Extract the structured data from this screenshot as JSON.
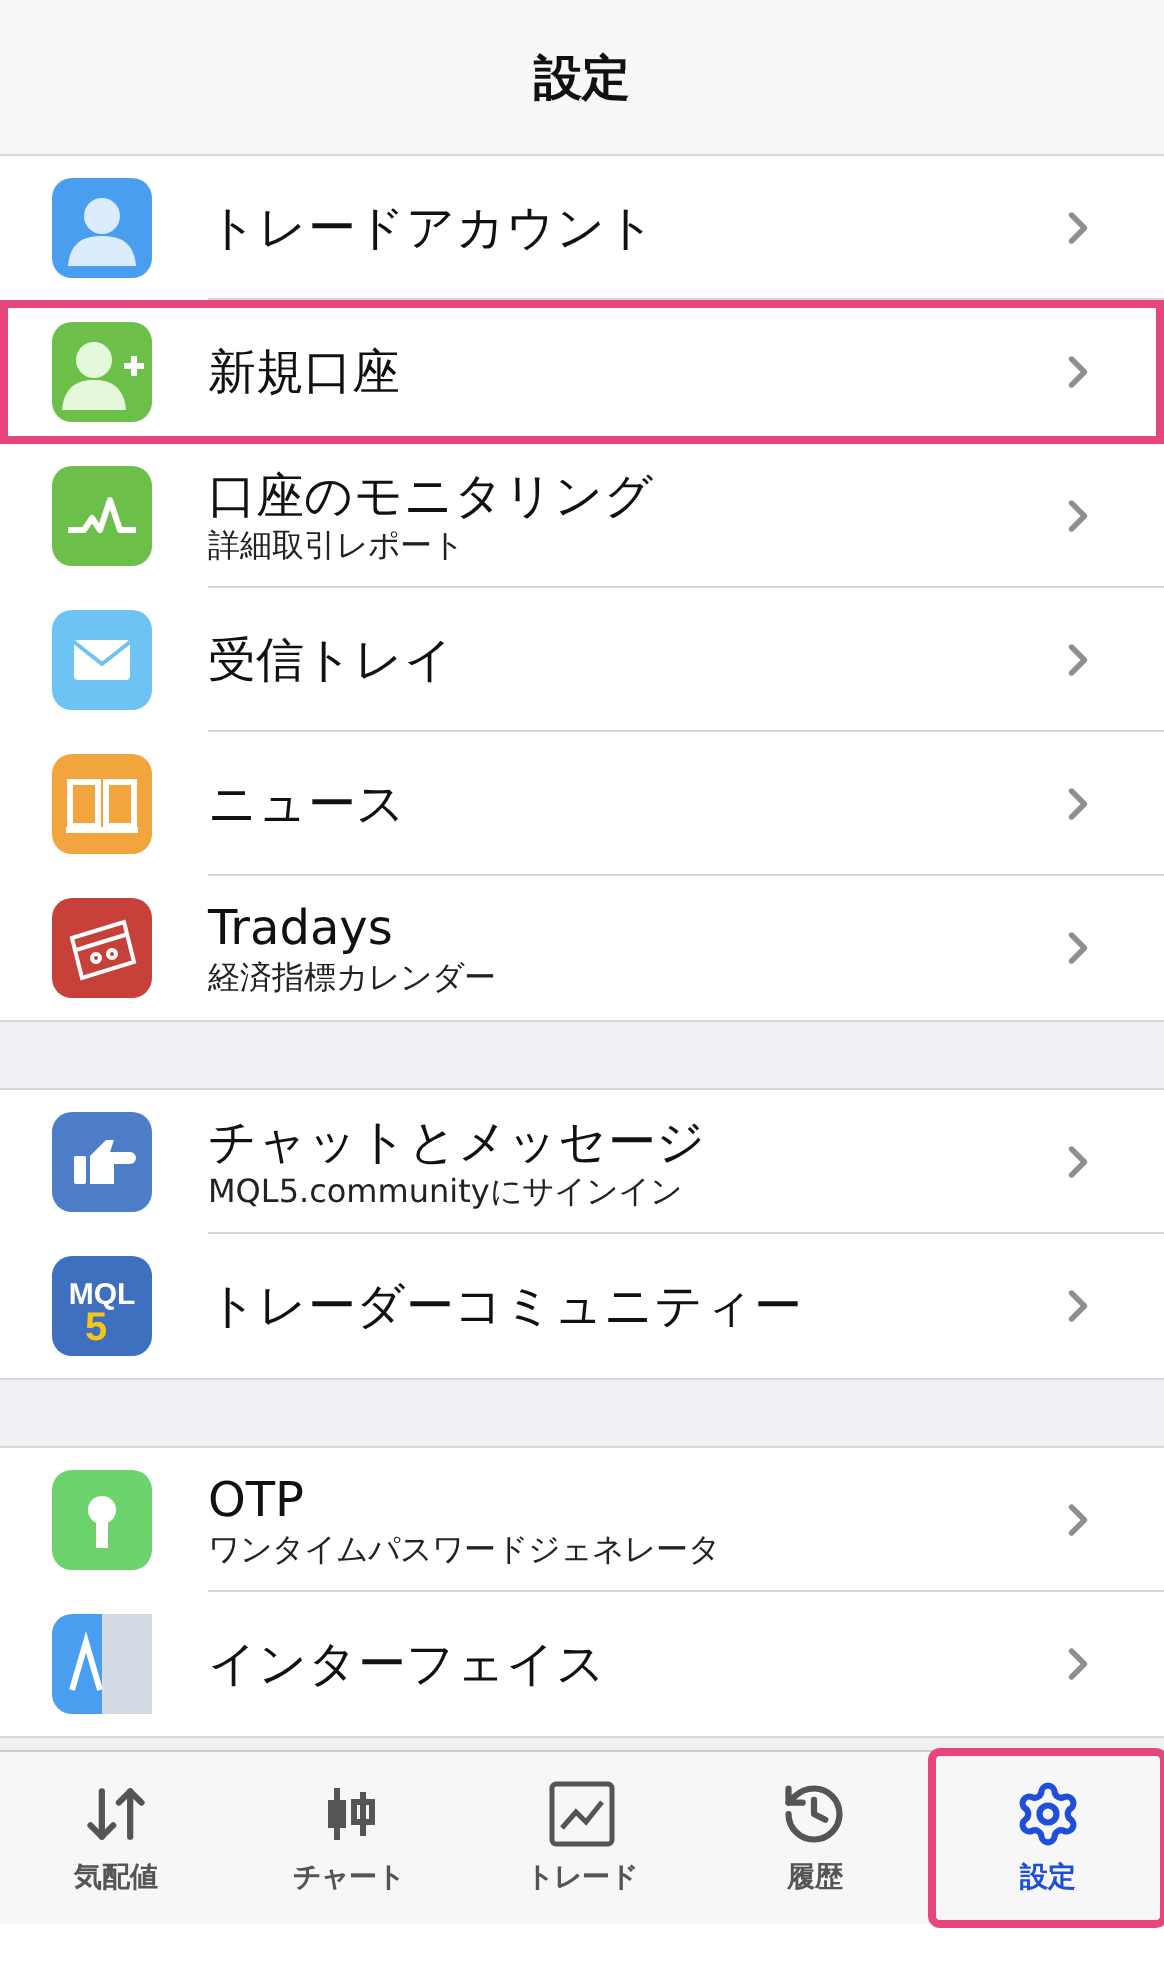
{
  "header": {
    "title": "設定"
  },
  "sections": [
    {
      "items": [
        {
          "title": "トレードアカウント",
          "highlighted": false
        },
        {
          "title": "新規口座",
          "highlighted": true
        },
        {
          "title": "口座のモニタリング",
          "subtitle": "詳細取引レポート",
          "highlighted": false
        },
        {
          "title": "受信トレイ",
          "highlighted": false
        },
        {
          "title": "ニュース",
          "highlighted": false
        },
        {
          "title": "Tradays",
          "subtitle": "経済指標カレンダー",
          "highlighted": false
        }
      ]
    },
    {
      "items": [
        {
          "title": "チャットとメッセージ",
          "subtitle": "MQL5.communityにサインイン",
          "highlighted": false
        },
        {
          "logo_text": "MQL",
          "logo_digit": "5",
          "title": "トレーダーコミュニティー",
          "highlighted": false
        }
      ]
    },
    {
      "items": [
        {
          "title": "OTP",
          "subtitle": "ワンタイムパスワードジェネレータ",
          "highlighted": false
        },
        {
          "title": "インターフェイス",
          "highlighted": false
        }
      ]
    }
  ],
  "tabs": [
    {
      "label": "気配値",
      "selected": false,
      "highlighted": false
    },
    {
      "label": "チャート",
      "selected": false,
      "highlighted": false
    },
    {
      "label": "トレード",
      "selected": false,
      "highlighted": false
    },
    {
      "label": "履歴",
      "selected": false,
      "highlighted": false
    },
    {
      "label": "設定",
      "selected": true,
      "highlighted": true
    }
  ]
}
